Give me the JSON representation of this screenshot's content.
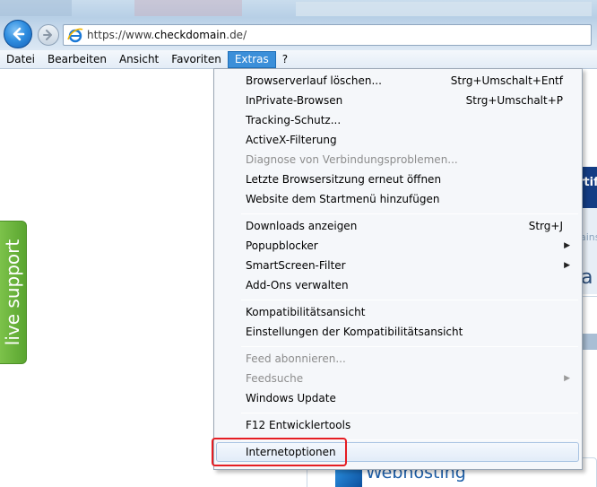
{
  "address_bar": {
    "url_prefix": "https://www.",
    "url_domain": "checkdomain",
    "url_suffix": ".de/"
  },
  "menubar": {
    "items": [
      "Datei",
      "Bearbeiten",
      "Ansicht",
      "Favoriten",
      "Extras",
      "?"
    ],
    "active": "Extras"
  },
  "dropdown": {
    "items": [
      {
        "label": "Browserverlauf löschen...",
        "shortcut": "Strg+Umschalt+Entf",
        "disabled": false
      },
      {
        "label": "InPrivate-Browsen",
        "shortcut": "Strg+Umschalt+P",
        "disabled": false
      },
      {
        "label": "Tracking-Schutz...",
        "shortcut": "",
        "disabled": false
      },
      {
        "label": "ActiveX-Filterung",
        "shortcut": "",
        "disabled": false
      },
      {
        "label": "Diagnose von Verbindungsproblemen...",
        "shortcut": "",
        "disabled": true
      },
      {
        "label": "Letzte Browsersitzung erneut öffnen",
        "shortcut": "",
        "disabled": false
      },
      {
        "label": "Website dem Startmenü hinzufügen",
        "shortcut": "",
        "disabled": false
      },
      {
        "label": "Downloads anzeigen",
        "shortcut": "Strg+J",
        "disabled": false
      },
      {
        "label": "Popupblocker",
        "shortcut": "",
        "disabled": false,
        "submenu": true
      },
      {
        "label": "SmartScreen-Filter",
        "shortcut": "",
        "disabled": false,
        "submenu": true
      },
      {
        "label": "Add-Ons verwalten",
        "shortcut": "",
        "disabled": false
      },
      {
        "label": "Kompatibilitätsansicht",
        "shortcut": "",
        "disabled": false
      },
      {
        "label": "Einstellungen der Kompatibilitätsansicht",
        "shortcut": "",
        "disabled": false
      },
      {
        "label": "Feed abonnieren...",
        "shortcut": "",
        "disabled": true
      },
      {
        "label": "Feedsuche",
        "shortcut": "",
        "disabled": true,
        "submenu": true
      },
      {
        "label": "Windows Update",
        "shortcut": "",
        "disabled": false
      },
      {
        "label": "F12 Entwicklertools",
        "shortcut": "",
        "disabled": false
      },
      {
        "label": "Internetoptionen",
        "shortcut": "",
        "disabled": false,
        "highlighted": true
      }
    ]
  },
  "page": {
    "live_support": "live support",
    "right_heading_fragment": "rtif",
    "right_small_fragment": "ains",
    "right_big_fragment": "a",
    "webhosting": "Webhosting"
  },
  "colors": {
    "highlight_border": "#e51d23",
    "menu_active": "#3b8fd9",
    "live_support_green": "#6cb63c"
  }
}
